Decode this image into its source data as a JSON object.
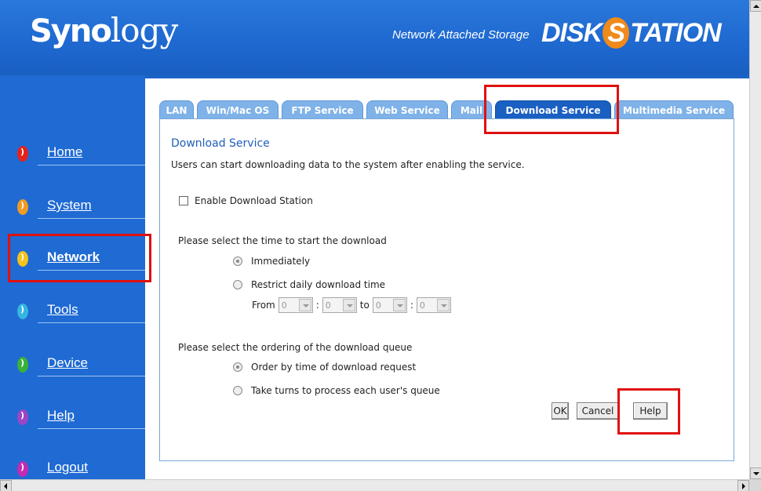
{
  "header": {
    "logo_bold": "Syno",
    "logo_light": "logy",
    "tagline": "Network Attached Storage",
    "brand_left": "DISK",
    "brand_s": "S",
    "brand_right": "TATION"
  },
  "sidebar": {
    "items": [
      {
        "label": "Home",
        "color": "#e4221b"
      },
      {
        "label": "System",
        "color": "#f19a22"
      },
      {
        "label": "Network",
        "color": "#f4c21b"
      },
      {
        "label": "Tools",
        "color": "#34b6e0"
      },
      {
        "label": "Device",
        "color": "#3ab23a"
      },
      {
        "label": "Help",
        "color": "#9a46c6"
      },
      {
        "label": "Logout",
        "color": "#c42bb3"
      }
    ],
    "active": "Network"
  },
  "tabs": [
    "LAN",
    "Win/Mac OS",
    "FTP Service",
    "Web Service",
    "Mail",
    "Download Service",
    "Multimedia Service"
  ],
  "active_tab": "Download Service",
  "main": {
    "title": "Download Service",
    "description": "Users can start downloading data to the system after enabling the service.",
    "enable_label": "Enable Download Station",
    "enable_checked": false,
    "time_section_label": "Please select the time to start the download",
    "time_options": [
      "Immediately",
      "Restrict daily download time"
    ],
    "time_selected": "Immediately",
    "from_label": "From",
    "to_label": "to",
    "colon": ":",
    "from_hour": "0",
    "from_min": "0",
    "to_hour": "0",
    "to_min": "0",
    "order_section_label": "Please select the ordering of the download queue",
    "order_options": [
      "Order by time of download request",
      "Take turns to process each user's queue"
    ],
    "order_selected": "Order by time of download request",
    "ok_label": "OK",
    "cancel_label": "Cancel",
    "help_label": "Help"
  },
  "colors": {
    "background": "#1a64c8",
    "highlight": "#e01010",
    "active_tab": "#1a5fc2",
    "inactive_tab": "#7fb2e8"
  }
}
